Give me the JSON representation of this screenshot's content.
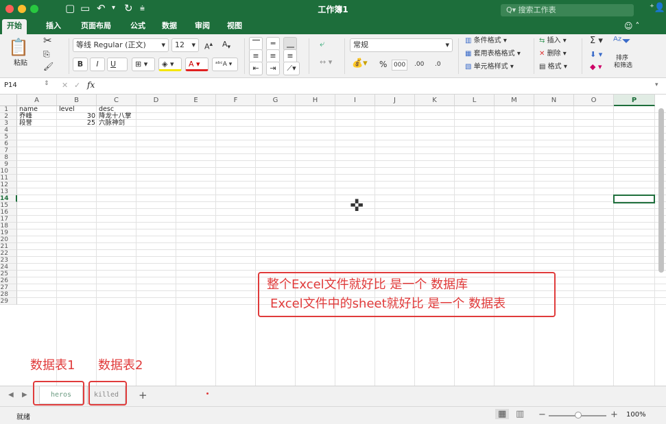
{
  "window": {
    "title": "工作簿1",
    "search_placeholder": "Q▾ 搜索工作表"
  },
  "colors": {
    "brand": "#1d6e3b",
    "annotation": "#e03a3a",
    "close": "#fc5f57",
    "minimize": "#fdbc2e",
    "maximize": "#28c840"
  },
  "tabs": [
    "开始",
    "插入",
    "页面布局",
    "公式",
    "数据",
    "审阅",
    "视图"
  ],
  "ribbon": {
    "paste": "粘贴",
    "font_name": "等线 Regular (正文)",
    "font_size": "12",
    "bold": "B",
    "italic": "I",
    "underline": "U",
    "number_format": "常规",
    "percent": "%",
    "thousands": "000",
    "inc_decimal": ".00",
    "dec_decimal": ".0",
    "cond_format": "条件格式 ▾",
    "table_format": "套用表格格式 ▾",
    "cell_style": "单元格样式 ▾",
    "insert": "插入 ▾",
    "delete": "删除 ▾",
    "format": "格式 ▾",
    "sort_filter_1": "排序",
    "sort_filter_2": "和筛选",
    "sum": "Σ ▾"
  },
  "formula": {
    "name_box": "P14",
    "fx": "fx",
    "value": ""
  },
  "columns": [
    "A",
    "B",
    "C",
    "D",
    "E",
    "F",
    "G",
    "H",
    "I",
    "J",
    "K",
    "L",
    "M",
    "N",
    "O",
    "P"
  ],
  "selected_column": "P",
  "selected_row": 14,
  "rows": [
    "1",
    "2",
    "3",
    "4",
    "5",
    "6",
    "7",
    "8",
    "9",
    "10",
    "11",
    "12",
    "13",
    "14",
    "15",
    "16",
    "17",
    "18",
    "19",
    "20",
    "21",
    "22",
    "23",
    "24",
    "25",
    "26",
    "27",
    "28",
    "29"
  ],
  "cells": {
    "A1": "name",
    "B1": "level",
    "C1": "desc",
    "A2": "乔峰",
    "B2": "30",
    "C2": "降龙十八掌",
    "A3": "段誉",
    "B3": "25",
    "C3": "六脉神剑"
  },
  "annotation": {
    "line1": "整个Excel文件就好比 是一个 数据库",
    "line2": "Excel文件中的sheet就好比 是一个 数据表",
    "label1": "数据表1",
    "label2": "数据表2"
  },
  "sheets": [
    "heros",
    "killed"
  ],
  "add_sheet": "+",
  "status": {
    "ready": "就绪",
    "zoom": "100%",
    "minus": "−",
    "plus": "+"
  }
}
